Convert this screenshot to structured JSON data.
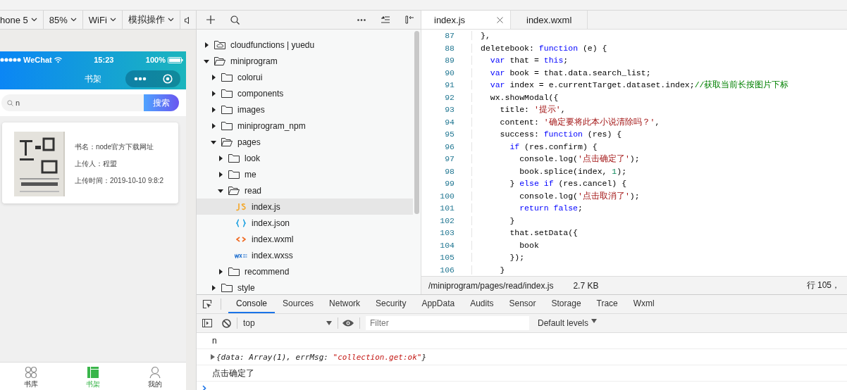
{
  "simulator": {
    "toolbar": [
      {
        "label": "hone 5"
      },
      {
        "label": "85%"
      },
      {
        "label": "WiFi"
      },
      {
        "label": "模拟操作"
      }
    ],
    "status_bar": {
      "carrier": "WeChat",
      "time": "15:23",
      "battery": "100%"
    },
    "nav_title": "书架",
    "search": {
      "value": "n",
      "button": "搜索"
    },
    "books": [
      {
        "title": "书名：node官方下载网址",
        "uploader": "上传人：程盟",
        "time": "上传时间：2019-10-10 9:8:2"
      }
    ],
    "tab_bar": [
      {
        "label": "书库",
        "kind": "library",
        "selected": false
      },
      {
        "label": "书架",
        "kind": "shelf",
        "selected": true
      },
      {
        "label": "我的",
        "kind": "profile",
        "selected": false
      }
    ]
  },
  "file_tree": {
    "items": [
      {
        "label": "cloudfunctions | yuedu",
        "kind": "cloud-folder",
        "expanded": false,
        "selected": false
      },
      {
        "label": "miniprogram",
        "kind": "folder",
        "expanded": true,
        "selected": false,
        "children": [
          {
            "label": "colorui",
            "kind": "folder",
            "expanded": false,
            "selected": false
          },
          {
            "label": "components",
            "kind": "folder",
            "expanded": false,
            "selected": false
          },
          {
            "label": "images",
            "kind": "folder",
            "expanded": false,
            "selected": false
          },
          {
            "label": "miniprogram_npm",
            "kind": "folder",
            "expanded": false,
            "selected": false
          },
          {
            "label": "pages",
            "kind": "folder",
            "expanded": true,
            "selected": false,
            "children": [
              {
                "label": "look",
                "kind": "folder",
                "expanded": false,
                "selected": false
              },
              {
                "label": "me",
                "kind": "folder",
                "expanded": false,
                "selected": false
              },
              {
                "label": "read",
                "kind": "folder",
                "expanded": true,
                "selected": false,
                "children": [
                  {
                    "label": "index.js",
                    "kind": "js",
                    "selected": true
                  },
                  {
                    "label": "index.json",
                    "kind": "json",
                    "selected": false
                  },
                  {
                    "label": "index.wxml",
                    "kind": "wxml",
                    "selected": false
                  },
                  {
                    "label": "index.wxss",
                    "kind": "wxss",
                    "selected": false
                  }
                ]
              },
              {
                "label": "recommend",
                "kind": "folder",
                "expanded": false,
                "selected": false
              }
            ]
          },
          {
            "label": "style",
            "kind": "folder",
            "expanded": false,
            "selected": false
          }
        ]
      }
    ]
  },
  "editor": {
    "tabs": [
      {
        "label": "index.js",
        "selected": true
      },
      {
        "label": "index.wxml",
        "selected": false
      }
    ],
    "lines": [
      {
        "number": "87",
        "tokens": [
          {
            "kind": "plain",
            "text": "},"
          }
        ]
      },
      {
        "number": "88",
        "tokens": [
          {
            "kind": "plain",
            "text": "deletebook: "
          },
          {
            "kind": "keyword",
            "text": "function"
          },
          {
            "kind": "plain",
            "text": " (e) {"
          }
        ]
      },
      {
        "number": "89",
        "tokens": [
          {
            "kind": "keyword",
            "text": "  var"
          },
          {
            "kind": "plain",
            "text": " that = "
          },
          {
            "kind": "keyword",
            "text": "this"
          },
          {
            "kind": "plain",
            "text": ";"
          }
        ]
      },
      {
        "number": "90",
        "tokens": [
          {
            "kind": "keyword",
            "text": "  var"
          },
          {
            "kind": "plain",
            "text": " book = that.data.search_list;"
          }
        ]
      },
      {
        "number": "91",
        "tokens": [
          {
            "kind": "keyword",
            "text": "  var"
          },
          {
            "kind": "plain",
            "text": " index = e.currentTarget.dataset.index;"
          },
          {
            "kind": "comment",
            "text": "//获取当前长按图片下标"
          }
        ]
      },
      {
        "number": "92",
        "tokens": [
          {
            "kind": "plain",
            "text": "  wx.showModal({"
          }
        ]
      },
      {
        "number": "93",
        "tokens": [
          {
            "kind": "plain",
            "text": "    title: "
          },
          {
            "kind": "string",
            "text": "'提示'"
          },
          {
            "kind": "plain",
            "text": ","
          }
        ]
      },
      {
        "number": "94",
        "tokens": [
          {
            "kind": "plain",
            "text": "    content: "
          },
          {
            "kind": "string",
            "text": "'确定要将此本小说清除吗？'"
          },
          {
            "kind": "plain",
            "text": ","
          }
        ]
      },
      {
        "number": "95",
        "tokens": [
          {
            "kind": "plain",
            "text": "    success: "
          },
          {
            "kind": "keyword",
            "text": "function"
          },
          {
            "kind": "plain",
            "text": " (res) {"
          }
        ]
      },
      {
        "number": "96",
        "tokens": [
          {
            "kind": "keyword",
            "text": "      if"
          },
          {
            "kind": "plain",
            "text": " (res.confirm) {"
          }
        ]
      },
      {
        "number": "97",
        "tokens": [
          {
            "kind": "plain",
            "text": "        console.log("
          },
          {
            "kind": "string",
            "text": "'点击确定了'"
          },
          {
            "kind": "plain",
            "text": ");"
          }
        ]
      },
      {
        "number": "98",
        "tokens": [
          {
            "kind": "plain",
            "text": "        book.splice(index, "
          },
          {
            "kind": "number",
            "text": "1"
          },
          {
            "kind": "plain",
            "text": ");"
          }
        ]
      },
      {
        "number": "99",
        "tokens": [
          {
            "kind": "plain",
            "text": "      } "
          },
          {
            "kind": "keyword",
            "text": "else if"
          },
          {
            "kind": "plain",
            "text": " (res.cancel) {"
          }
        ]
      },
      {
        "number": "100",
        "tokens": [
          {
            "kind": "plain",
            "text": "        console.log("
          },
          {
            "kind": "string",
            "text": "'点击取消了'"
          },
          {
            "kind": "plain",
            "text": ");"
          }
        ]
      },
      {
        "number": "101",
        "tokens": [
          {
            "kind": "keyword",
            "text": "        return false"
          },
          {
            "kind": "plain",
            "text": ";"
          }
        ]
      },
      {
        "number": "102",
        "tokens": [
          {
            "kind": "plain",
            "text": "      }"
          }
        ]
      },
      {
        "number": "103",
        "tokens": [
          {
            "kind": "plain",
            "text": "      that.setData({"
          }
        ]
      },
      {
        "number": "104",
        "tokens": [
          {
            "kind": "plain",
            "text": "        book"
          }
        ]
      },
      {
        "number": "105",
        "tokens": [
          {
            "kind": "plain",
            "text": "      });"
          }
        ]
      },
      {
        "number": "106",
        "tokens": [
          {
            "kind": "plain",
            "text": "    }"
          }
        ]
      }
    ],
    "status_bar": {
      "path": "/miniprogram/pages/read/index.js",
      "size": "2.7 KB",
      "position": "行 105，"
    }
  },
  "devtools": {
    "tabs": [
      {
        "label": "Console",
        "selected": true
      },
      {
        "label": "Sources",
        "selected": false
      },
      {
        "label": "Network",
        "selected": false
      },
      {
        "label": "Security",
        "selected": false
      },
      {
        "label": "AppData",
        "selected": false
      },
      {
        "label": "Audits",
        "selected": false
      },
      {
        "label": "Sensor",
        "selected": false
      },
      {
        "label": "Storage",
        "selected": false
      },
      {
        "label": "Trace",
        "selected": false
      },
      {
        "label": "Wxml",
        "selected": false
      }
    ],
    "context": "top",
    "filter_placeholder": "Filter",
    "levels": "Default levels",
    "messages": [
      {
        "kind": "text",
        "tokens": [
          {
            "kind": "plain",
            "text": "n"
          }
        ]
      },
      {
        "kind": "object",
        "tokens": [
          {
            "kind": "plain",
            "text": "{data: Array(1), errMsg: "
          },
          {
            "kind": "string",
            "text": "\"collection.get:ok\""
          },
          {
            "kind": "plain",
            "text": "}"
          }
        ]
      },
      {
        "kind": "text",
        "tokens": [
          {
            "kind": "plain",
            "text": "点击确定了"
          }
        ]
      }
    ]
  }
}
